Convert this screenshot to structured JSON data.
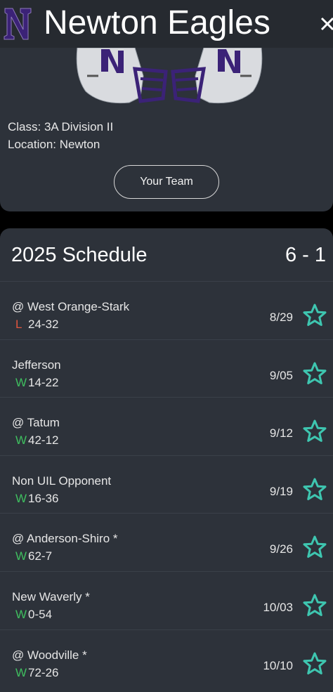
{
  "header": {
    "title": "Newton Eagles",
    "logo_letter": "N"
  },
  "team": {
    "class_line": "Class: 3A Division II",
    "location_line": "Location: Newton",
    "your_team_label": "Your Team"
  },
  "schedule": {
    "title": "2025 Schedule",
    "record": "6 - 1",
    "games": [
      {
        "opponent": "@ West Orange-Stark",
        "result": "L",
        "score": "24-32",
        "date": "8/29"
      },
      {
        "opponent": "Jefferson",
        "result": "W",
        "score": "14-22",
        "date": "9/05"
      },
      {
        "opponent": "@ Tatum",
        "result": "W",
        "score": "42-12",
        "date": "9/12"
      },
      {
        "opponent": "Non UIL Opponent",
        "result": "W",
        "score": "16-36",
        "date": "9/19"
      },
      {
        "opponent": "@ Anderson-Shiro *",
        "result": "W",
        "score": "62-7",
        "date": "9/26"
      },
      {
        "opponent": "New Waverly *",
        "result": "W",
        "score": "0-54",
        "date": "10/03"
      },
      {
        "opponent": "@ Woodville *",
        "result": "W",
        "score": "72-26",
        "date": "10/10"
      }
    ]
  },
  "colors": {
    "win": "#3fbf5f",
    "loss": "#e0553f",
    "star": "#3ec6b0",
    "team_purple": "#3b2277"
  }
}
